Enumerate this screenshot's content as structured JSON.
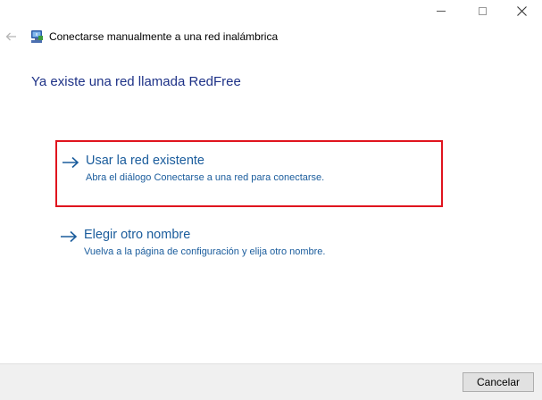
{
  "window": {
    "title": "Conectarse manualmente a una red inalámbrica"
  },
  "heading": "Ya existe una red llamada RedFree",
  "options": [
    {
      "title": "Usar la red existente",
      "description": "Abra el diálogo Conectarse a una red para conectarse.",
      "highlighted": true,
      "highlight_color": "#e0141e"
    },
    {
      "title": "Elegir otro nombre",
      "description": "Vuelva a la página de configuración y elija otro nombre.",
      "highlighted": false
    }
  ],
  "footer": {
    "cancel_label": "Cancelar"
  },
  "icons": {
    "back": "back-arrow-icon",
    "network": "network-icon",
    "option_arrow": "arrow-right-icon",
    "minimize": "minimize-icon",
    "maximize": "maximize-icon",
    "close": "close-icon"
  },
  "colors": {
    "heading": "#1e3287",
    "link": "#1a5c9c",
    "footer_bg": "#f0f0f0"
  }
}
